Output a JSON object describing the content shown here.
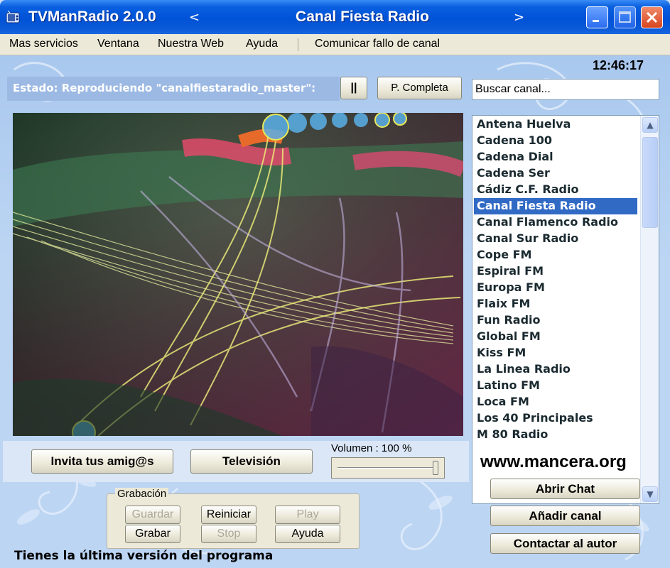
{
  "window": {
    "app_title": "TVManRadio 2.0.0",
    "prev_arrow": "<",
    "station_title": "Canal Fiesta Radio",
    "next_arrow": ">"
  },
  "menu": {
    "items": [
      "Mas servicios",
      "Ventana",
      "Nuestra Web",
      "Ayuda"
    ],
    "report": "Comunicar fallo de canal"
  },
  "clock": "12:46:17",
  "status": {
    "label": "Estado:  Reproduciendo \"canalfiestaradio_master\":",
    "pause_label": "||",
    "fullscreen_label": "P. Completa"
  },
  "search": {
    "value": "Buscar canal..."
  },
  "channels": {
    "selected": "Canal Fiesta Radio",
    "items": [
      "Antena Huelva",
      "Cadena 100",
      "Cadena Dial",
      "Cadena Ser",
      "Cádiz C.F. Radio",
      "Canal Fiesta Radio",
      "Canal Flamenco Radio",
      "Canal Sur Radio",
      "Cope FM",
      "Espiral FM",
      "Europa FM",
      "Flaix FM",
      "Fun Radio",
      "Global FM",
      "Kiss FM",
      "La Linea Radio",
      "Latino FM",
      "Loca FM",
      "Los 40 Principales",
      "M 80 Radio"
    ]
  },
  "bottom": {
    "invite_label": "Invita tus amig@s",
    "tv_label": "Televisión",
    "volume_label": "Volumen : 100 %",
    "volume_level": 1.0,
    "website": "www.mancera.org",
    "chat_label": "Abrir Chat",
    "add_label": "Añadir canal",
    "contact_label": "Contactar al autor"
  },
  "recording": {
    "legend": "Grabación",
    "guardar": "Guardar",
    "reiniciar": "Reiniciar",
    "play": "Play",
    "grabar": "Grabar",
    "stop": "Stop",
    "ayuda": "Ayuda"
  },
  "footer": {
    "status": "Tienes la última versión del programa"
  },
  "colors": {
    "titlebar": "#0052d6",
    "selection": "#316ac5",
    "background": "#bcd5f3"
  },
  "icons": [
    "app-icon",
    "minimize-icon",
    "maximize-icon",
    "close-icon",
    "scroll-up-icon",
    "scroll-down-icon"
  ]
}
